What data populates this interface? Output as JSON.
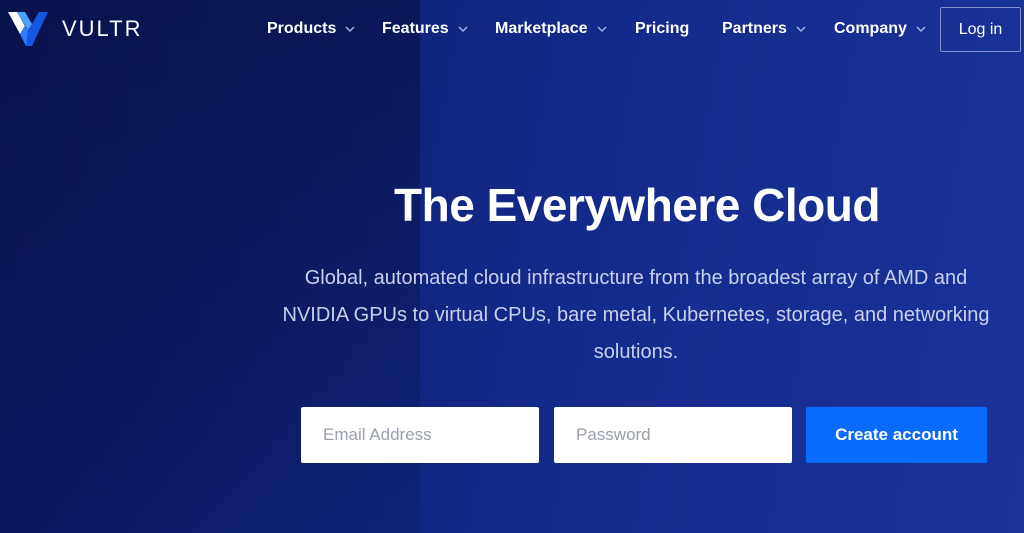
{
  "header": {
    "logo_text": "VULTR",
    "nav": [
      {
        "label": "Products",
        "has_dropdown": true
      },
      {
        "label": "Features",
        "has_dropdown": true
      },
      {
        "label": "Marketplace",
        "has_dropdown": true
      },
      {
        "label": "Pricing",
        "has_dropdown": false
      },
      {
        "label": "Partners",
        "has_dropdown": true
      },
      {
        "label": "Company",
        "has_dropdown": true
      }
    ],
    "login_label": "Log in"
  },
  "hero": {
    "title": "The Everywhere Cloud",
    "subtitle": "Global, automated cloud infrastructure from the broadest array of AMD and NVIDIA GPUs to virtual CPUs, bare metal, Kubernetes, storage, and networking solutions."
  },
  "signup": {
    "email_placeholder": "Email Address",
    "password_placeholder": "Password",
    "cta_label": "Create account"
  },
  "colors": {
    "accent": "#0a6cff",
    "logo_light": "#4aa3ff",
    "logo_dark": "#1656e0",
    "background_dark": "#0a1660",
    "background_light": "#1a3399"
  },
  "icons": {
    "logo": "vultr-logo-icon",
    "dropdown": "chevron-down-icon"
  }
}
